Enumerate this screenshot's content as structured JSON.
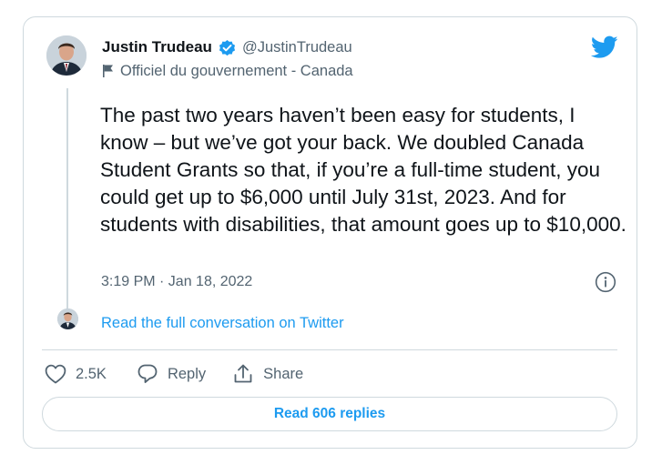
{
  "tweet": {
    "author_name": "Justin Trudeau",
    "author_handle": "@JustinTrudeau",
    "account_label": "Officiel du gouvernement - Canada",
    "text": "The past two years haven’t been easy for students, I know – but we’ve got your back. We doubled Canada Student Grants so that, if you’re a full-time student, you could get up to $6,000 until July 31st, 2023. And for students with disabilities, that amount goes up to $10,000.",
    "timestamp": "3:19 PM · Jan 18, 2022",
    "conversation_link": "Read the full conversation on Twitter"
  },
  "actions": {
    "like_count": "2.5K",
    "reply_label": "Reply",
    "share_label": "Share",
    "read_replies_label": "Read 606 replies"
  },
  "icons": {
    "verified": "verified-badge-icon",
    "label": "flag-icon",
    "brand": "twitter-bird-icon",
    "info": "info-icon",
    "like": "heart-icon",
    "reply": "speech-bubble-icon",
    "share": "share-icon"
  },
  "colors": {
    "brand_blue": "#1d9bf0",
    "text_primary": "#0f1419",
    "text_secondary": "#536471",
    "border": "#cfd9de"
  }
}
